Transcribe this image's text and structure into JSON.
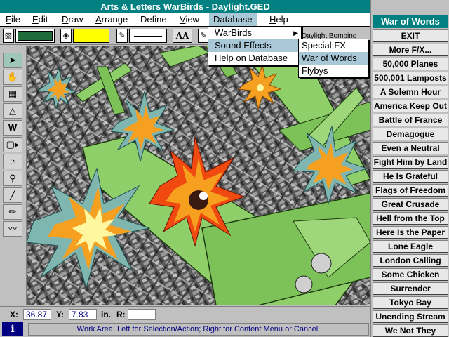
{
  "window": {
    "title": "Arts & Letters WarBirds - Daylight.GED"
  },
  "menubar": {
    "items": [
      {
        "label": "File",
        "mn": "F",
        "rest": "ile"
      },
      {
        "label": "Edit",
        "mn": "E",
        "rest": "dit"
      },
      {
        "label": "Draw",
        "mn": "D",
        "rest": "raw"
      },
      {
        "label": "Arrange",
        "mn": "A",
        "rest": "rrange"
      },
      {
        "label": "Define",
        "mn": "",
        "rest": "Define"
      },
      {
        "label": "View",
        "mn": "V",
        "rest": "iew"
      },
      {
        "label": "Database",
        "mn": "",
        "rest": "Database"
      },
      {
        "label": "Help",
        "mn": "H",
        "rest": "elp"
      }
    ]
  },
  "toolbar": {
    "text_style_label": "AA",
    "fill_color": "#ffff00",
    "line_color": "#1f6b3a"
  },
  "database_menu": {
    "items": [
      {
        "label": "WarBirds"
      },
      {
        "label": "Sound Effects"
      },
      {
        "label": "Help on Database"
      }
    ]
  },
  "sound_submenu": {
    "items": [
      {
        "label": "Special FX"
      },
      {
        "label": "War of Words"
      },
      {
        "label": "Flybys"
      }
    ]
  },
  "background_label": "Daylight Bombing",
  "panel": {
    "title": "War of Words",
    "items": [
      "EXIT",
      "More F/X...",
      "50,000 Planes",
      "500,001 Lamposts",
      "A Solemn Hour",
      "America Keep Out",
      "Battle of France",
      "Demagogue",
      "Even a Neutral",
      "Fight Him by Land",
      "He Is Grateful",
      "Flags of Freedom",
      "Great Crusade",
      "Hell from the Top",
      "Here Is the Paper",
      "Lone Eagle",
      "London Calling",
      "Some Chicken",
      "Surrender",
      "Tokyo Bay",
      "Unending Stream",
      "We Not They"
    ]
  },
  "coords": {
    "x_label": "X:",
    "x_value": "36.87",
    "y_label": "Y:",
    "y_value": "7.83",
    "unit": "in.",
    "r_label": "R:",
    "r_value": ""
  },
  "status": {
    "info_icon": "i",
    "text": "Work Area: Left for Selection/Action; Right for Content Menu or Cancel."
  },
  "colors": {
    "title_bar": "#008080",
    "highlight": "#a8c8d8",
    "status_text": "#000080"
  }
}
